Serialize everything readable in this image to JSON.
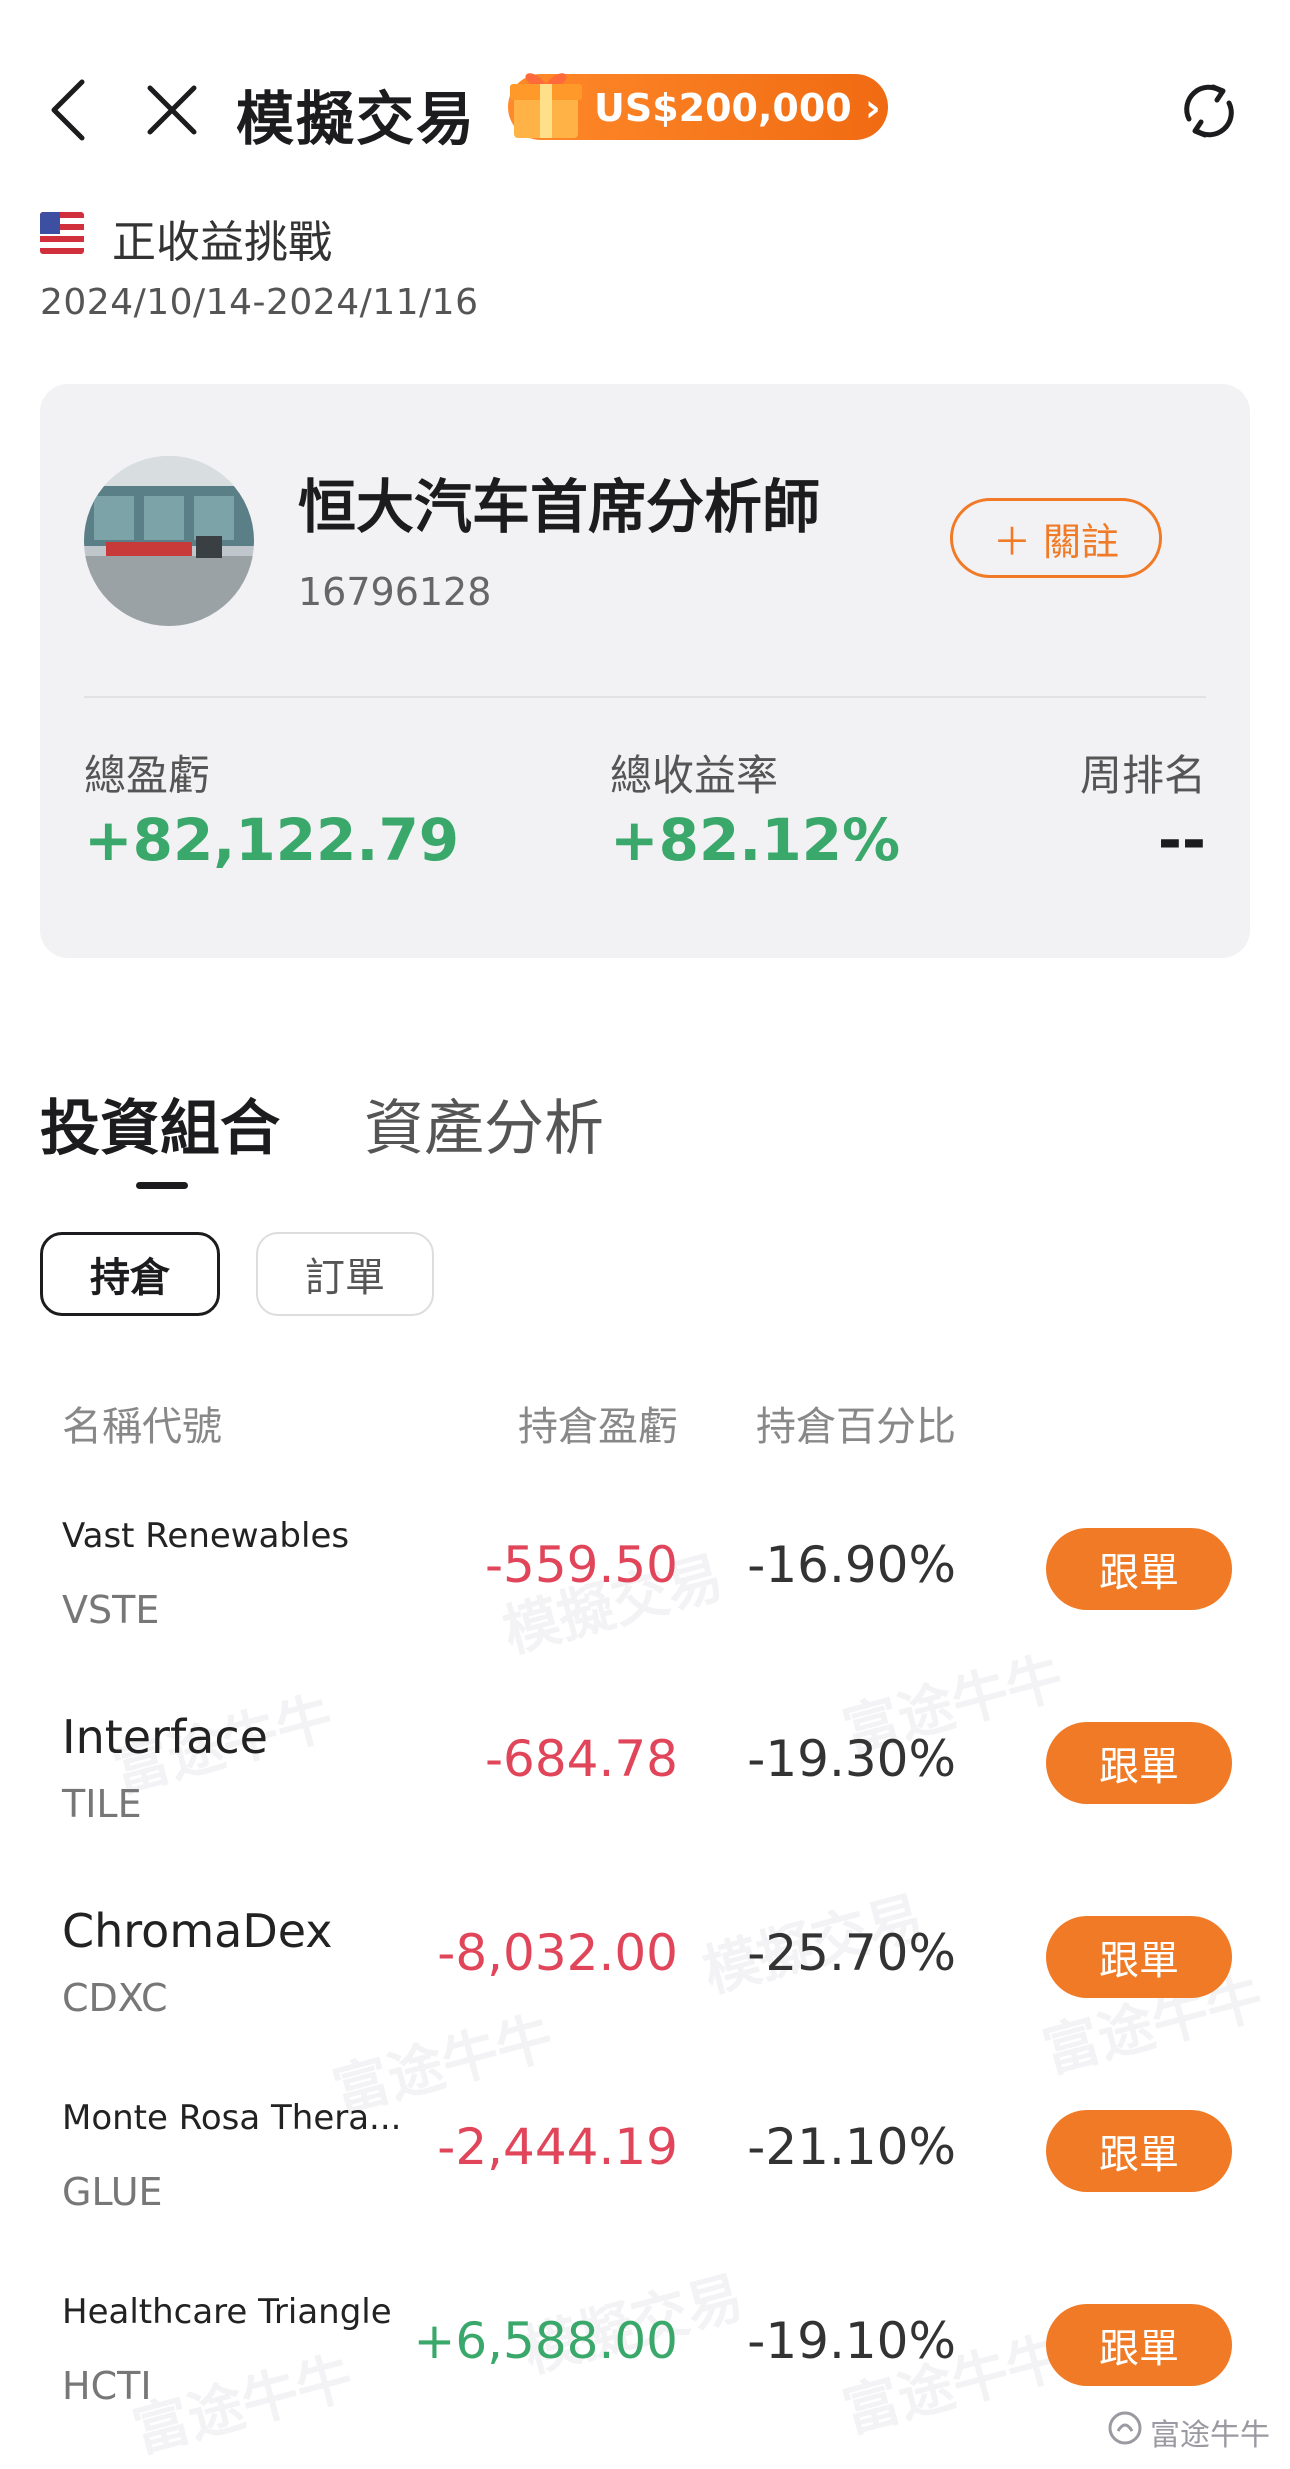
{
  "header": {
    "title": "模擬交易",
    "promo_label": "US$200,000",
    "promo_arrow": "›"
  },
  "contest": {
    "name": "正收益挑戰",
    "date_range": "2024/10/14-2024/11/16"
  },
  "profile": {
    "name": "恒大汽车首席分析師",
    "id": "16796128",
    "follow_label": "＋ 關註",
    "stats": [
      {
        "label": "總盈虧",
        "value": "+82,122.79"
      },
      {
        "label": "總收益率",
        "value": "+82.12%"
      },
      {
        "label": "周排名",
        "value": "--"
      }
    ]
  },
  "tabs": {
    "active": "投資組合",
    "inactive": "資產分析"
  },
  "segments": {
    "active": "持倉",
    "inactive": "訂單"
  },
  "table": {
    "headers": [
      "名稱代號",
      "持倉盈虧",
      "持倉百分比"
    ],
    "follow_button_label": "跟單",
    "rows": [
      {
        "name": "Vast Renewables",
        "code": "VSTE",
        "pnl": "-559.50",
        "pct": "-16.90%"
      },
      {
        "name": "Interface",
        "code": "TILE",
        "pnl": "-684.78",
        "pct": "-19.30%"
      },
      {
        "name": "ChromaDex",
        "code": "CDXC",
        "pnl": "-8,032.00",
        "pct": "-25.70%"
      },
      {
        "name": "Monte Rosa Thera...",
        "code": "GLUE",
        "pnl": "-2,444.19",
        "pct": "-21.10%"
      },
      {
        "name": "Healthcare Triangle",
        "code": "HCTI",
        "pnl": "+6,588.00",
        "pct": "-19.10%"
      }
    ]
  },
  "watermarks": {
    "trade": "模擬交易",
    "brand": "富途牛牛"
  },
  "colors": {
    "accent": "#f07a25",
    "positive": "#3aa86b",
    "negative": "#e0455a"
  }
}
